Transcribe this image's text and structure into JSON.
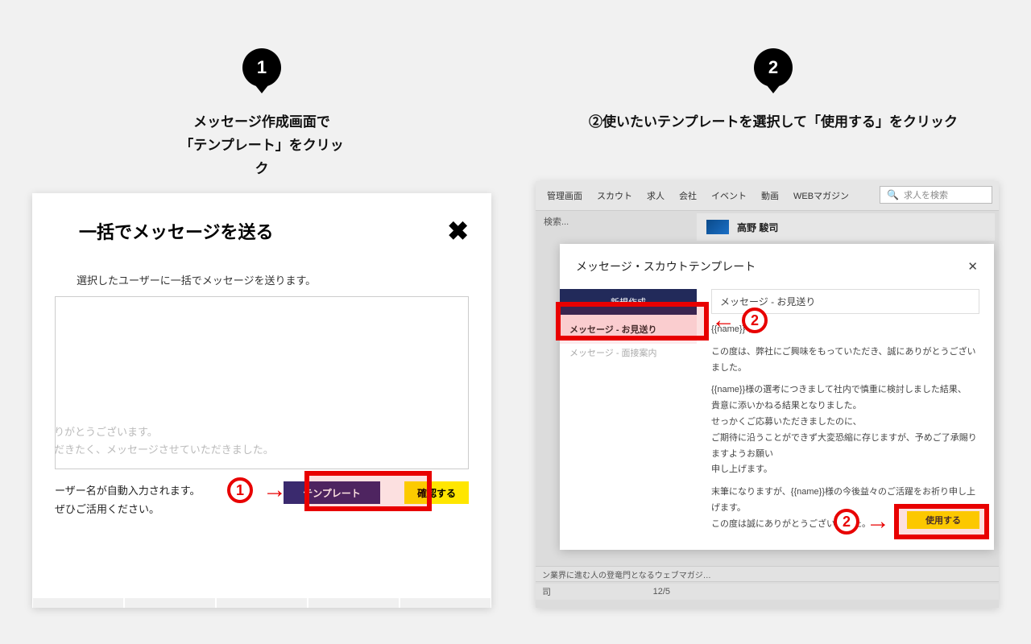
{
  "left": {
    "badge_num": "1",
    "caption_line1": "メッセージ作成画面で",
    "caption_line2": "「テンプレート」をクリック",
    "modal_title": "一括でメッセージを送る",
    "modal_sub": "選択したユーザーに一括でメッセージを送ります。",
    "ta_line1": "りがとうございます。",
    "ta_line2": "だきたく、メッセージさせていただきました。",
    "auto_line1": "ーザー名が自動入力されます。",
    "auto_line2": "ぜひご活用ください。",
    "template_btn": "テンプレート",
    "confirm_btn": "確認する",
    "circ_num": "1"
  },
  "right": {
    "badge_num": "2",
    "caption": "②使いたいテンプレートを選択して「使用する」をクリック",
    "nav": {
      "kanri": "管理画面",
      "scout": "スカウト",
      "kyujin": "求人",
      "kaisha": "会社",
      "event": "イベント",
      "douga": "動画",
      "webmag": "WEBマガジン"
    },
    "search_ph": "求人を検索",
    "kensaku": "検索...",
    "user_name": "高野 駿司",
    "modal_title": "メッセージ・スカウトテンプレート",
    "new_btn": "新規作成",
    "tmpl_sel": "メッセージ - お見送り",
    "tmpl_2": "メッセージ - 面接案内",
    "preview_title": "メッセージ - お見送り",
    "pv_nameline": "{{name}} 様",
    "pv_p1": "この度は、弊社にご興味をもっていただき、誠にありがとうございました。",
    "pv_p2a": "{{name}}様の選考につきまして社内で慎重に検討しました結果、",
    "pv_p2b": "貴意に添いかねる結果となりました。",
    "pv_p2c": "せっかくご応募いただきましたのに、",
    "pv_p2d": "ご期待に沿うことができず大変恐縮に存じますが、予めご了承賜りますようお願い",
    "pv_p2e": "申し上げます。",
    "pv_p3a": "末筆になりますが、{{name}}様の今後益々のご活躍をお祈り申し上げます。",
    "pv_p3b": "この度は誠にありがとうございました。",
    "use_btn": "使用する",
    "circ_top": "2",
    "circ_bottom": "2",
    "mag_row": "ン業界に進む人の登竜門となるウェブマガジ…",
    "date_s": "司",
    "date_d": "12/5"
  }
}
